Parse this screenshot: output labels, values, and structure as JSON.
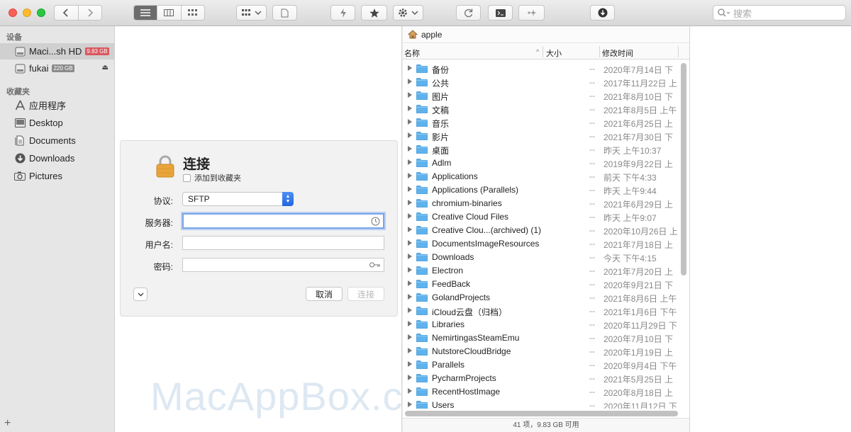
{
  "toolbar": {
    "search_placeholder": "搜索"
  },
  "sidebar": {
    "devices_heading": "设备",
    "favorites_heading": "收藏夹",
    "devices": [
      {
        "label": "Maci...sh HD",
        "badge": "9.83 GB",
        "badge_color": "#d9575e"
      },
      {
        "label": "fukai",
        "badge": "220 GB",
        "badge_color": "#8a8a8a"
      }
    ],
    "favorites": [
      {
        "label": "应用程序",
        "icon": "apps-icon"
      },
      {
        "label": "Desktop",
        "icon": "desktop-icon"
      },
      {
        "label": "Documents",
        "icon": "documents-icon"
      },
      {
        "label": "Downloads",
        "icon": "downloads-icon"
      },
      {
        "label": "Pictures",
        "icon": "pictures-icon"
      }
    ],
    "add_label": "+"
  },
  "connect": {
    "title": "连接",
    "favorite_label": "添加到收藏夹",
    "protocol_label": "协议:",
    "protocol_value": "SFTP",
    "server_label": "服务器:",
    "username_label": "用户名:",
    "password_label": "密码:",
    "cancel_label": "取消",
    "connect_label": "连接"
  },
  "watermark": "MacAppBox.com",
  "files": {
    "path": "apple",
    "col_name": "名称",
    "col_size": "大小",
    "col_date": "修改时间",
    "rows": [
      {
        "name": "备份",
        "size": "--",
        "date": "2020年7月14日 下"
      },
      {
        "name": "公共",
        "size": "--",
        "date": "2017年11月22日 上"
      },
      {
        "name": "图片",
        "size": "--",
        "date": "2021年8月10日 下"
      },
      {
        "name": "文稿",
        "size": "--",
        "date": "2021年8月5日 上午"
      },
      {
        "name": "音乐",
        "size": "--",
        "date": "2021年6月25日 上"
      },
      {
        "name": "影片",
        "size": "--",
        "date": "2021年7月30日 下"
      },
      {
        "name": "桌面",
        "size": "--",
        "date": "昨天 上午10:37"
      },
      {
        "name": "Adlm",
        "size": "--",
        "date": "2019年9月22日 上"
      },
      {
        "name": "Applications",
        "size": "--",
        "date": "前天 下午4:33"
      },
      {
        "name": "Applications (Parallels)",
        "size": "--",
        "date": "昨天 上午9:44"
      },
      {
        "name": "chromium-binaries",
        "size": "--",
        "date": "2021年6月29日 上"
      },
      {
        "name": "Creative Cloud Files",
        "size": "--",
        "date": "昨天 上午9:07"
      },
      {
        "name": "Creative Clou...(archived) (1)",
        "size": "--",
        "date": "2020年10月26日 上"
      },
      {
        "name": "DocumentsImageResources",
        "size": "--",
        "date": "2021年7月18日 上"
      },
      {
        "name": "Downloads",
        "size": "--",
        "date": "今天 下午4:15"
      },
      {
        "name": "Electron",
        "size": "--",
        "date": "2021年7月20日 上"
      },
      {
        "name": "FeedBack",
        "size": "--",
        "date": "2020年9月21日 下"
      },
      {
        "name": "GolandProjects",
        "size": "--",
        "date": "2021年8月6日 上午"
      },
      {
        "name": "iCloud云盘（归档）",
        "size": "--",
        "date": "2021年1月6日 下午"
      },
      {
        "name": "Libraries",
        "size": "--",
        "date": "2020年11月29日 下"
      },
      {
        "name": "NemirtingasSteamEmu",
        "size": "--",
        "date": "2020年7月10日 下"
      },
      {
        "name": "NutstoreCloudBridge",
        "size": "--",
        "date": "2020年1月19日 上"
      },
      {
        "name": "Parallels",
        "size": "--",
        "date": "2020年9月4日 下午"
      },
      {
        "name": "PycharmProjects",
        "size": "--",
        "date": "2021年5月25日 上"
      },
      {
        "name": "RecentHostImage",
        "size": "--",
        "date": "2020年8月18日 上"
      },
      {
        "name": "Users",
        "size": "--",
        "date": "2020年11月12日 下"
      }
    ],
    "status": "41 项，9.83 GB 可用"
  }
}
